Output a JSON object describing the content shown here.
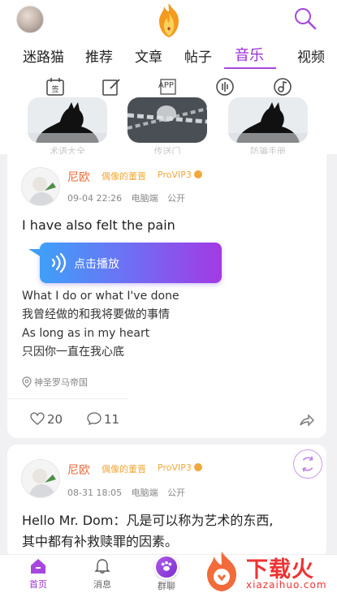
{
  "header": {
    "tabs": [
      {
        "label": "迷路猫"
      },
      {
        "label": "推荐"
      },
      {
        "label": "文章"
      },
      {
        "label": "帖子"
      },
      {
        "label": "音乐"
      },
      {
        "label": "视频"
      }
    ],
    "active_tab": "音乐",
    "quick_icons": [
      "calendar-icon",
      "edit-icon",
      "app-icon",
      "music-record-icon",
      "music-note-icon"
    ],
    "quick_app_label": "APP",
    "banners": [
      {
        "label": "术语大全"
      },
      {
        "label": "传送门"
      },
      {
        "label": "防骗手册"
      }
    ]
  },
  "posts": [
    {
      "author": "尼欧",
      "title": "偶像的董晋",
      "vip": "ProVIP3",
      "time": "09-04 22:26",
      "device": "电脑端",
      "visibility": "公开",
      "text": "I have also felt the pain",
      "play_label": "点击播放",
      "lyrics": [
        "What I do or what I've done",
        "我曾经做的和我将要做的事情",
        "As long as in my heart",
        "只因你一直在我心底"
      ],
      "location": "神圣罗马帝国",
      "likes": "20",
      "comments": "11"
    },
    {
      "author": "尼欧",
      "title": "偶像的董晋",
      "vip": "ProVIP3",
      "time": "08-31 18:05",
      "device": "电脑端",
      "visibility": "公开",
      "text_lines": [
        "Hello Mr. Dom：凡是可以称为艺术的东西,",
        "其中都有补救赎罪的因素。"
      ]
    }
  ],
  "bottom_nav": [
    {
      "label": "首页",
      "icon": "home-icon"
    },
    {
      "label": "消息",
      "icon": "bell-icon"
    },
    {
      "label": "群聊",
      "icon": "paw-icon"
    }
  ],
  "watermark": {
    "title": "下载火",
    "subtitle": "xiazaihuo.com"
  },
  "colors": {
    "accent": "#9a2fd6",
    "author": "#ee6a3a",
    "vip": "#f0a83b",
    "play_gradient_start": "#3fa0f8",
    "play_gradient_end": "#a23ae4"
  }
}
